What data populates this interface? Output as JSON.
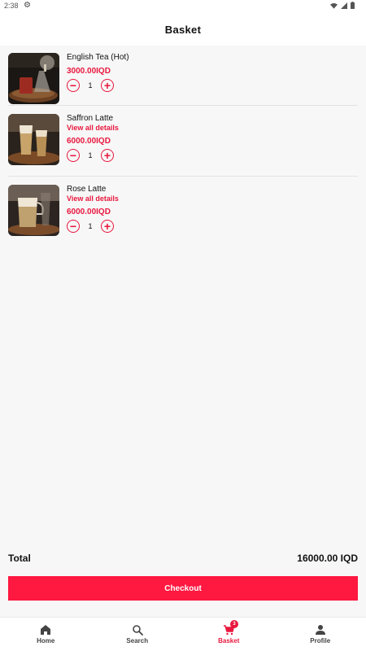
{
  "status_bar": {
    "time": "2:38"
  },
  "header": {
    "title": "Basket"
  },
  "basket": {
    "items": [
      {
        "name": "English Tea (Hot)",
        "link": "",
        "price": "3000.00IQD",
        "qty": "1",
        "image": "tea-cup-photo"
      },
      {
        "name": "Saffron Latte",
        "link": "View all details",
        "price": "6000.00IQD",
        "qty": "1",
        "image": "latte-glass-photo"
      },
      {
        "name": "Rose Latte",
        "link": "View all details",
        "price": "6000.00IQD",
        "qty": "1",
        "image": "latte-glass-photo"
      }
    ],
    "minus_symbol": "−",
    "plus_symbol": "+"
  },
  "summary": {
    "total_label": "Total",
    "total_value": "16000.00 IQD",
    "checkout_label": "Checkout"
  },
  "nav": {
    "items": [
      {
        "label": "Home",
        "icon": "home-icon"
      },
      {
        "label": "Search",
        "icon": "search-icon"
      },
      {
        "label": "Basket",
        "icon": "cart-icon",
        "badge": "3"
      },
      {
        "label": "Profile",
        "icon": "person-icon"
      }
    ]
  },
  "colors": {
    "accent": "#e8173e",
    "checkout": "#ff1840",
    "background": "#f7f7f7"
  }
}
